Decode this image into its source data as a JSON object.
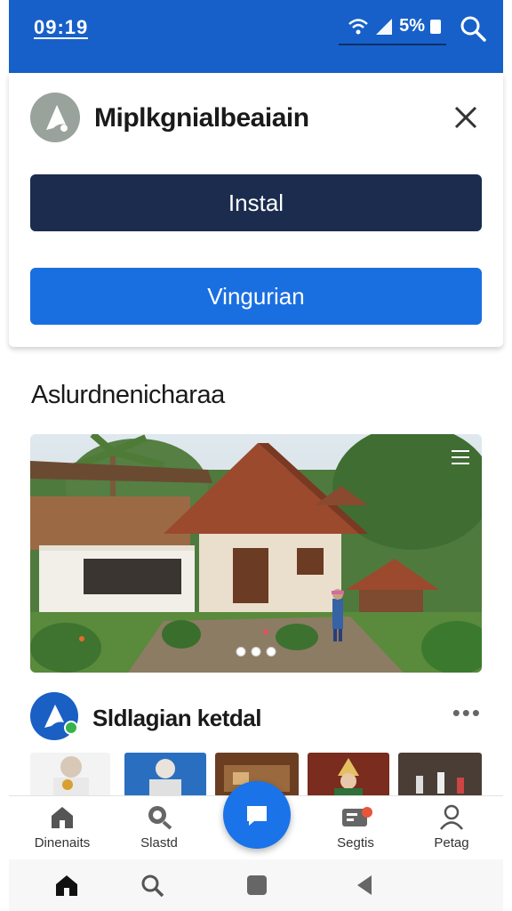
{
  "status_bar": {
    "time": "09:19",
    "battery": "5%",
    "color": "#1760c9"
  },
  "install_card": {
    "app_name": "Miplkgnialbeaiain",
    "install_label": "Instal",
    "secondary_label": "Vingurian"
  },
  "section": {
    "title": "Aslurdnenicharaa",
    "carousel_slides": 3
  },
  "post": {
    "author": "Sldlagian ketdal",
    "more": "•••"
  },
  "tabs": [
    {
      "label": "Dinenaits",
      "icon": "home-icon"
    },
    {
      "label": "Slastd",
      "icon": "search-icon"
    },
    {
      "label": "Segtis",
      "icon": "messages-icon"
    },
    {
      "label": "Petag",
      "icon": "profile-icon"
    }
  ],
  "fab_icon": "chat-icon",
  "colors": {
    "accent": "#1a73e8",
    "install_button": "#1b2c4e",
    "secondary_button": "#1a6fe0"
  }
}
